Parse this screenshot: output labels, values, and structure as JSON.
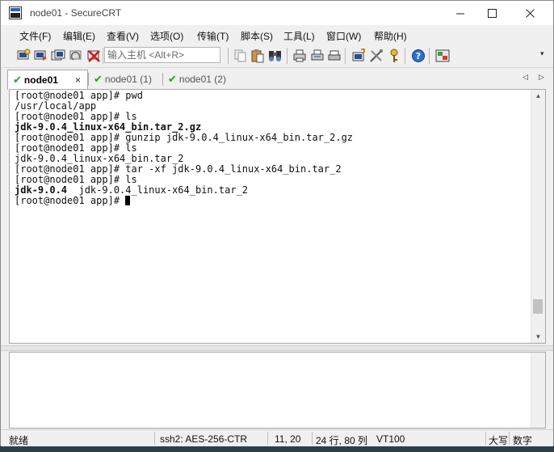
{
  "window": {
    "title": "node01 - SecureCRT"
  },
  "menu": {
    "items": [
      {
        "label": "文件(F)"
      },
      {
        "label": "编辑(E)"
      },
      {
        "label": "查看(V)"
      },
      {
        "label": "选项(O)"
      },
      {
        "label": "传输(T)"
      },
      {
        "label": "脚本(S)"
      },
      {
        "label": "工具(L)"
      },
      {
        "label": "窗口(W)"
      },
      {
        "label": "帮助(H)"
      }
    ]
  },
  "toolbar": {
    "host_placeholder": "输入主机 <Alt+R>",
    "icons": [
      "connect-icon",
      "quick-connect-icon",
      "connect-tab-icon",
      "reconnect-icon",
      "disconnect-icon",
      "copy-icon",
      "paste-icon",
      "find-icon",
      "print-icon",
      "print-setup-icon",
      "print-screen-icon",
      "session-options-icon",
      "global-options-icon",
      "keymap-icon",
      "help-icon",
      "sftp-icon"
    ]
  },
  "tabs": [
    {
      "label": "node01",
      "active": true,
      "close": "×"
    },
    {
      "label": "node01 (1)",
      "active": false
    },
    {
      "label": "node01 (2)",
      "active": false
    }
  ],
  "terminal": {
    "lines": [
      {
        "text": "[root@node01 app]# pwd",
        "bold": false
      },
      {
        "text": "/usr/local/app",
        "bold": false
      },
      {
        "text": "[root@node01 app]# ls",
        "bold": false
      },
      {
        "text": "jdk-9.0.4_linux-x64_bin.tar_2.gz",
        "bold": true
      },
      {
        "text": "[root@node01 app]# gunzip jdk-9.0.4_linux-x64_bin.tar_2.gz",
        "bold": false
      },
      {
        "text": "[root@node01 app]# ls",
        "bold": false
      },
      {
        "text": "jdk-9.0.4_linux-x64_bin.tar_2",
        "bold": false
      },
      {
        "text": "[root@node01 app]# tar -xf jdk-9.0.4_linux-x64_bin.tar_2",
        "bold": false
      },
      {
        "text": "[root@node01 app]# ls",
        "bold": false
      },
      {
        "text": "jdk-9.0.4",
        "bold": true,
        "rest": "  jdk-9.0.4_linux-x64_bin.tar_2"
      },
      {
        "text": "[root@node01 app]# ",
        "bold": false,
        "cursor": true
      }
    ],
    "scroll_position": 0.92
  },
  "status": {
    "ready": "就绪",
    "cipher": "ssh2: AES-256-CTR",
    "position": "11,  20",
    "size": "24 行, 80 列",
    "terminal_type": "VT100",
    "caps": "大写",
    "num": "数字"
  }
}
